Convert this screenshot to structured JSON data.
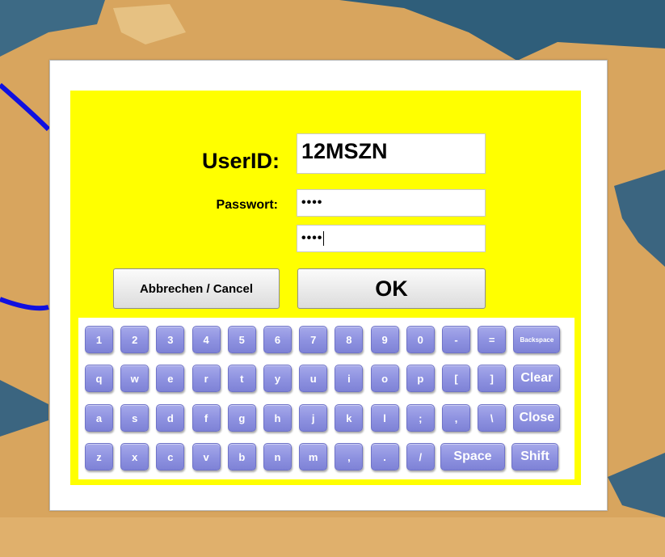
{
  "login": {
    "userid_label": "UserID:",
    "userid_value": "12MSZN",
    "password_label": "Passwort:",
    "password_mask": "••••",
    "password_confirm_mask": "••••",
    "cancel_label": "Abbrechen / Cancel",
    "ok_label": "OK"
  },
  "keyboard": {
    "row1": [
      "1",
      "2",
      "3",
      "4",
      "5",
      "6",
      "7",
      "8",
      "9",
      "0",
      "-",
      "=",
      "Backspace"
    ],
    "row2": [
      "q",
      "w",
      "e",
      "r",
      "t",
      "y",
      "u",
      "i",
      "o",
      "p",
      "[",
      "]",
      "Clear"
    ],
    "row3": [
      "a",
      "s",
      "d",
      "f",
      "g",
      "h",
      "j",
      "k",
      "l",
      ";",
      ",",
      "\\",
      "Close"
    ],
    "row4": [
      "z",
      "x",
      "c",
      "v",
      "b",
      "n",
      "m",
      ",",
      ".",
      "/",
      "Space",
      "Shift"
    ]
  },
  "colors": {
    "panel": "#ffff00",
    "key": "#8d91e0",
    "background_map": "#d8a55e"
  }
}
